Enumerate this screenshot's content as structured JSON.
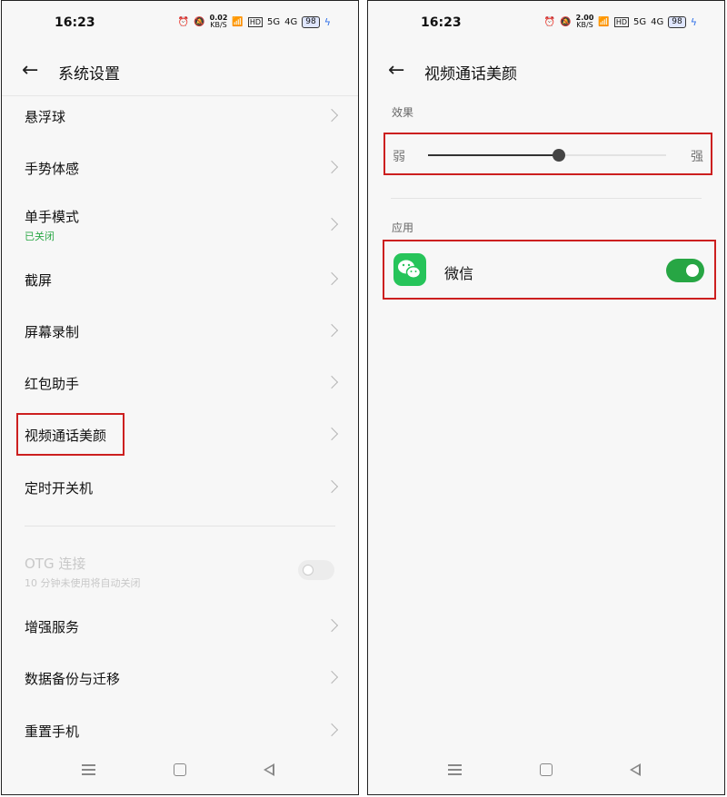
{
  "left": {
    "status": {
      "time": "16:23",
      "speed_top": "0.02",
      "speed_unit": "KB/S",
      "hd": "HD",
      "sig1": "5G",
      "sig2": "4G",
      "battery": "98"
    },
    "header": {
      "title": "系统设置"
    },
    "items": [
      {
        "label": "悬浮球"
      },
      {
        "label": "手势体感"
      },
      {
        "label": "单手模式",
        "sub": "已关闭"
      },
      {
        "label": "截屏"
      },
      {
        "label": "屏幕录制"
      },
      {
        "label": "红包助手"
      },
      {
        "label": "视频通话美颜"
      },
      {
        "label": "定时开关机"
      }
    ],
    "otg": {
      "label": "OTG 连接",
      "sub": "10 分钟未使用将自动关闭"
    },
    "items2": [
      {
        "label": "增强服务"
      },
      {
        "label": "数据备份与迁移"
      },
      {
        "label": "重置手机"
      }
    ]
  },
  "right": {
    "status": {
      "time": "16:23",
      "speed_top": "2.00",
      "speed_unit": "KB/S",
      "hd": "HD",
      "sig1": "5G",
      "sig2": "4G",
      "battery": "98"
    },
    "header": {
      "title": "视频通话美颜"
    },
    "effect": {
      "section": "效果",
      "weak": "弱",
      "strong": "强",
      "level": 0.55
    },
    "apps": {
      "section": "应用",
      "items": [
        {
          "name": "微信",
          "enabled": true
        }
      ]
    }
  },
  "colors": {
    "accent_green": "#27a644",
    "highlight_red": "#cc1f1f",
    "wechat_green": "#26c45a"
  }
}
